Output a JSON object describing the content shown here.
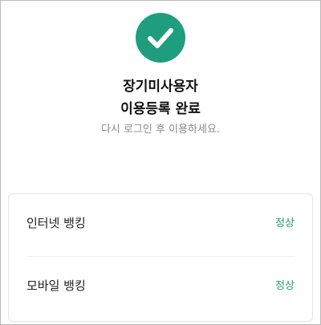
{
  "header": {
    "icon": "check-circle-icon",
    "title_line1": "장기미사용자",
    "title_line2": "이용등록 완료",
    "subtitle": "다시 로그인 후 이용하세요."
  },
  "services": [
    {
      "name": "인터넷 뱅킹",
      "status": "정상"
    },
    {
      "name": "모바일 뱅킹",
      "status": "정상"
    }
  ],
  "colors": {
    "accent": "#1f9d7f",
    "title": "#111111",
    "subtitle": "#8a8a8a"
  }
}
